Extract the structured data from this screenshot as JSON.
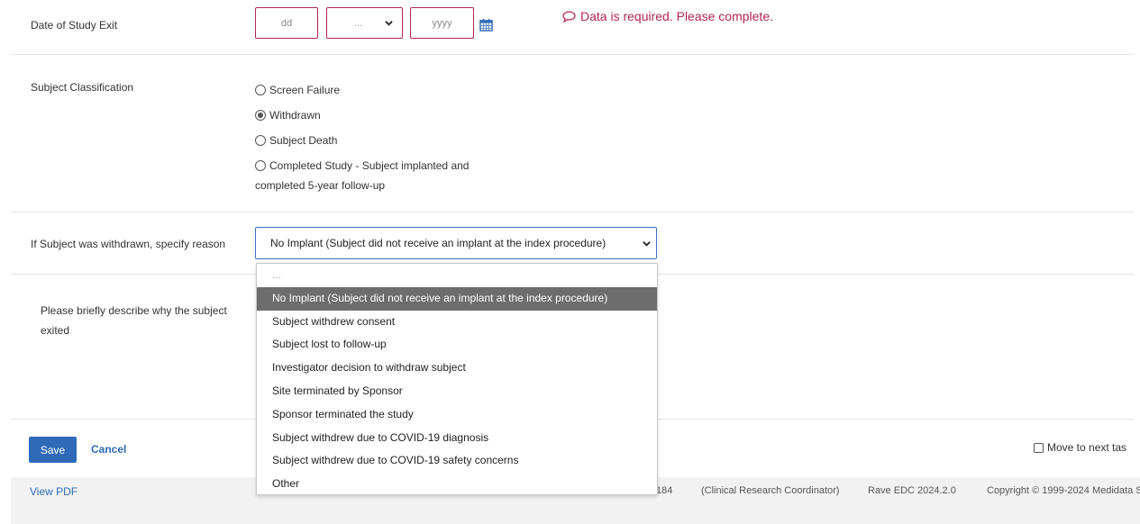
{
  "exit_date": {
    "label": "Date of Study Exit",
    "day_placeholder": "dd",
    "month_value": "...",
    "year_placeholder": "yyyy",
    "error": "Data is required. Please complete."
  },
  "classification": {
    "label": "Subject Classification",
    "options": [
      {
        "label": "Screen Failure",
        "checked": false
      },
      {
        "label": "Withdrawn",
        "checked": true
      },
      {
        "label": "Subject Death",
        "checked": false
      },
      {
        "label": "Completed Study - Subject implanted and",
        "label2": "completed 5-year follow-up",
        "checked": false
      }
    ]
  },
  "withdraw_reason": {
    "label": "If Subject was withdrawn, specify reason",
    "selected": "No Implant (Subject did not receive an implant at the index procedure)",
    "options": [
      "...",
      "No Implant (Subject did not receive an implant at the index procedure)",
      "Subject withdrew consent",
      "Subject lost to follow-up",
      "Investigator decision to withdraw subject",
      "Site terminated by Sponsor",
      "Sponsor terminated the study",
      "Subject withdrew due to COVID-19 diagnosis",
      "Subject withdrew due to COVID-19 safety concerns",
      "Other"
    ]
  },
  "describe": {
    "label_line1": "Please briefly describe why the subject",
    "label_line2": "exited"
  },
  "actions": {
    "save": "Save",
    "cancel": "Cancel",
    "move_next": "Move to next tas"
  },
  "footer": {
    "view_pdf": "View PDF",
    "partial_id": "184",
    "role": "(Clinical Research Coordinator)",
    "version": "Rave EDC 2024.2.0",
    "copyright": "Copyright © 1999-2024 Medidata S"
  },
  "colors": {
    "error": "#b0264f",
    "accent": "#2e6ab8",
    "selected_option_bg": "#6d6d6d"
  }
}
